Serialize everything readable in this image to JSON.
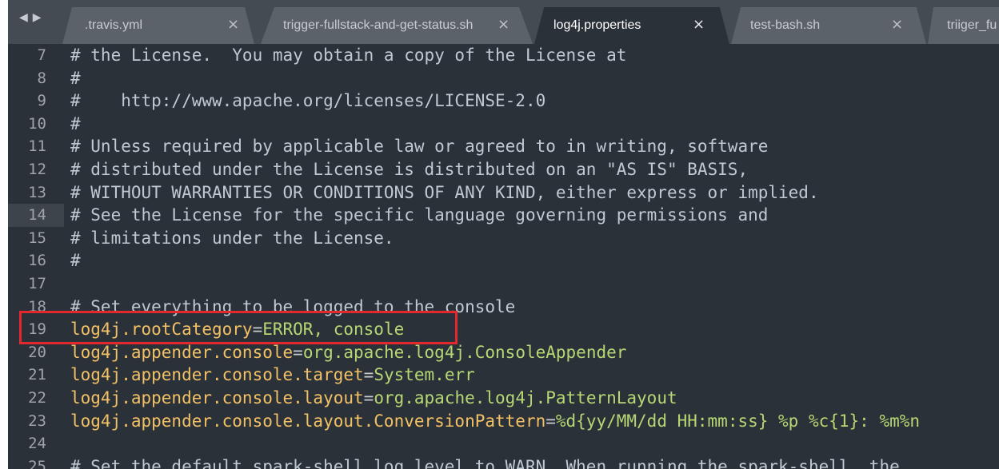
{
  "tabs": [
    {
      "label": ".travis.yml",
      "close": "×",
      "active": false
    },
    {
      "label": "trigger-fullstack-and-get-status.sh",
      "close": "×",
      "active": false
    },
    {
      "label": "log4j.properties",
      "close": "×",
      "active": true
    },
    {
      "label": "test-bash.sh",
      "close": "×",
      "active": false
    },
    {
      "label": "triiger_fu",
      "close": "",
      "active": false
    }
  ],
  "nav": {
    "back": "◀",
    "forward": "▶"
  },
  "lines": [
    {
      "num": "7",
      "comment": "# the License.  You may obtain a copy of the License at"
    },
    {
      "num": "8",
      "comment": "#"
    },
    {
      "num": "9",
      "comment": "#    http://www.apache.org/licenses/LICENSE-2.0"
    },
    {
      "num": "10",
      "comment": "#"
    },
    {
      "num": "11",
      "comment": "# Unless required by applicable law or agreed to in writing, software"
    },
    {
      "num": "12",
      "comment": "# distributed under the License is distributed on an \"AS IS\" BASIS,"
    },
    {
      "num": "13",
      "comment": "# WITHOUT WARRANTIES OR CONDITIONS OF ANY KIND, either express or implied."
    },
    {
      "num": "14",
      "comment": "# See the License for the specific language governing permissions and",
      "current": true
    },
    {
      "num": "15",
      "comment": "# limitations under the License."
    },
    {
      "num": "16",
      "comment": "#"
    },
    {
      "num": "17",
      "comment": ""
    },
    {
      "num": "18",
      "comment": "# Set everything to be logged to the console"
    },
    {
      "num": "19",
      "key": "log4j.rootCategory",
      "eq": "=",
      "val": "ERROR, console"
    },
    {
      "num": "20",
      "key": "log4j.appender.console",
      "eq": "=",
      "val": "org.apache.log4j.ConsoleAppender"
    },
    {
      "num": "21",
      "key": "log4j.appender.console.target",
      "eq": "=",
      "val": "System.err"
    },
    {
      "num": "22",
      "key": "log4j.appender.console.layout",
      "eq": "=",
      "val": "org.apache.log4j.PatternLayout"
    },
    {
      "num": "23",
      "key": "log4j.appender.console.layout.ConversionPattern",
      "eq": "=",
      "val": "%d{yy/MM/dd HH:mm:ss} %p %c{1}: %m%n"
    },
    {
      "num": "24",
      "comment": ""
    },
    {
      "num": "25",
      "comment": "# Set the default spark-shell log level to WARN. When running the spark-shell, the"
    }
  ],
  "colors": {
    "background": "#2b3138",
    "comment": "#bfc9d2",
    "key": "#f3c165",
    "value": "#b6d774",
    "highlight": "#e3282e"
  }
}
